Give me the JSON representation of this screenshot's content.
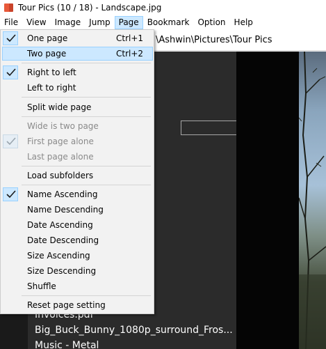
{
  "window": {
    "title": "Tour Pics (10 / 18) - Landscape.jpg",
    "icon": "book-icon"
  },
  "menubar": {
    "items": [
      "File",
      "View",
      "Image",
      "Jump",
      "Page",
      "Bookmark",
      "Option",
      "Help"
    ],
    "open": "Page"
  },
  "address": {
    "path_visible": "\\Ashwin\\Pictures\\Tour Pics"
  },
  "file_list": {
    "items": [
      "Invoices.pdf",
      "Big_Buck_Bunny_1080p_surround_Fros...",
      "Music - Metal"
    ]
  },
  "page_menu": {
    "items": [
      {
        "label": "One page",
        "shortcut": "Ctrl+1",
        "checked": true,
        "enabled": true,
        "highlighted": false
      },
      {
        "label": "Two page",
        "shortcut": "Ctrl+2",
        "checked": false,
        "enabled": true,
        "highlighted": true
      },
      {
        "label": "Right to left",
        "checked": true,
        "enabled": true
      },
      {
        "label": "Left to right",
        "checked": false,
        "enabled": true
      },
      {
        "label": "Split wide page",
        "checked": false,
        "enabled": true
      },
      {
        "label": "Wide is two page",
        "checked": false,
        "enabled": false
      },
      {
        "label": "First page alone",
        "checked": true,
        "enabled": false
      },
      {
        "label": "Last page alone",
        "checked": false,
        "enabled": false
      },
      {
        "label": "Load subfolders",
        "checked": false,
        "enabled": true
      },
      {
        "label": "Name Ascending",
        "checked": true,
        "enabled": true
      },
      {
        "label": "Name Descending",
        "checked": false,
        "enabled": true
      },
      {
        "label": "Date Ascending",
        "checked": false,
        "enabled": true
      },
      {
        "label": "Date Descending",
        "checked": false,
        "enabled": true
      },
      {
        "label": "Size Ascending",
        "checked": false,
        "enabled": true
      },
      {
        "label": "Size Descending",
        "checked": false,
        "enabled": true
      },
      {
        "label": "Shuffle",
        "checked": false,
        "enabled": true
      },
      {
        "label": "Reset page setting",
        "checked": false,
        "enabled": true
      }
    ]
  },
  "colors": {
    "highlight": "#cce8ff",
    "highlight_border": "#99d1ff",
    "check": "#1a1a1a",
    "disabled_text": "#8a8a8a",
    "panel_bg": "#2b2b2b",
    "accent_dots": "#3c8fd6"
  }
}
